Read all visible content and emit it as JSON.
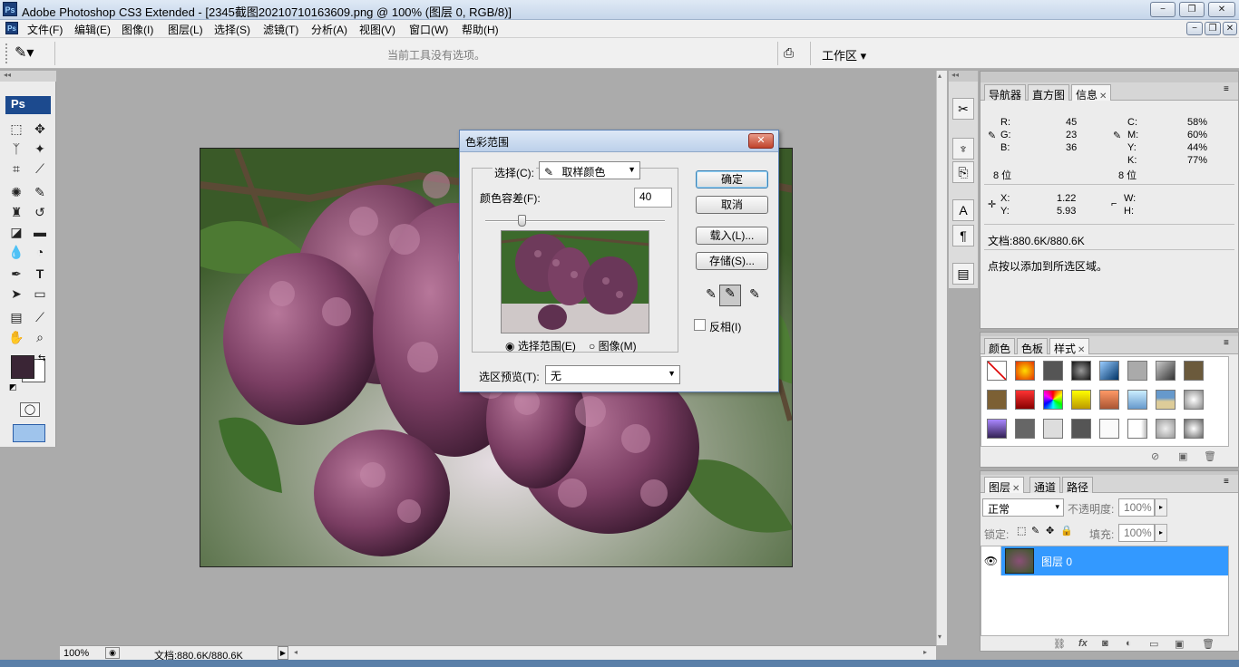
{
  "window": {
    "app_icon": "Ps",
    "title": "Adobe Photoshop CS3 Extended - [2345截图20210710163609.png @ 100% (图层 0, RGB/8)]",
    "controls": [
      "−",
      "❐",
      "✕"
    ]
  },
  "menu": {
    "items": [
      "文件(F)",
      "编辑(E)",
      "图像(I)",
      "图层(L)",
      "选择(S)",
      "滤镜(T)",
      "分析(A)",
      "视图(V)",
      "窗口(W)",
      "帮助(H)"
    ]
  },
  "options_bar": {
    "hint": "当前工具没有选项。",
    "workspace_label": "工作区"
  },
  "status_bar": {
    "zoom": "100%",
    "doc_info": "文档:880.6K/880.6K"
  },
  "dialog": {
    "title": "色彩范围",
    "select_label": "选择(C):",
    "select_value": "取样颜色",
    "fuzziness_label": "颜色容差(F):",
    "fuzziness_value": "40",
    "fuzziness_fraction": 0.2,
    "radio_selection": "选择范围(E)",
    "radio_image": "图像(M)",
    "preview_label": "选区预览(T):",
    "preview_value": "无",
    "ok": "确定",
    "cancel": "取消",
    "load": "载入(L)...",
    "save": "存储(S)...",
    "invert": "反相(I)"
  },
  "info_panel": {
    "tabs": [
      "导航器",
      "直方图",
      "信息"
    ],
    "rgb": [
      {
        "label": "R:",
        "value": "45"
      },
      {
        "label": "G:",
        "value": "23"
      },
      {
        "label": "B:",
        "value": "36"
      }
    ],
    "cmyk": [
      {
        "label": "C:",
        "value": "58%"
      },
      {
        "label": "M:",
        "value": "60%"
      },
      {
        "label": "Y:",
        "value": "44%"
      },
      {
        "label": "K:",
        "value": "77%"
      }
    ],
    "bit_left": "8 位",
    "bit_right": "8 位",
    "xy": [
      {
        "label": "X:",
        "value": "1.22"
      },
      {
        "label": "Y:",
        "value": "5.93"
      }
    ],
    "wh": [
      {
        "label": "W:",
        "value": ""
      },
      {
        "label": "H:",
        "value": ""
      }
    ],
    "doc": "文档:880.6K/880.6K",
    "tip": "点按以添加到所选区域。"
  },
  "styles_panel": {
    "tabs": [
      "颜色",
      "色板",
      "样式"
    ]
  },
  "layers_panel": {
    "tabs": [
      "图层",
      "通道",
      "路径"
    ],
    "blend_mode": "正常",
    "opacity_label": "不透明度:",
    "opacity_value": "100%",
    "lock_label": "锁定:",
    "fill_label": "填充:",
    "fill_value": "100%",
    "layer_name": "图层 0"
  },
  "colors": {
    "foreground": "#3a2535",
    "background": "#ffffff",
    "layer_highlight": "#3399ff"
  }
}
